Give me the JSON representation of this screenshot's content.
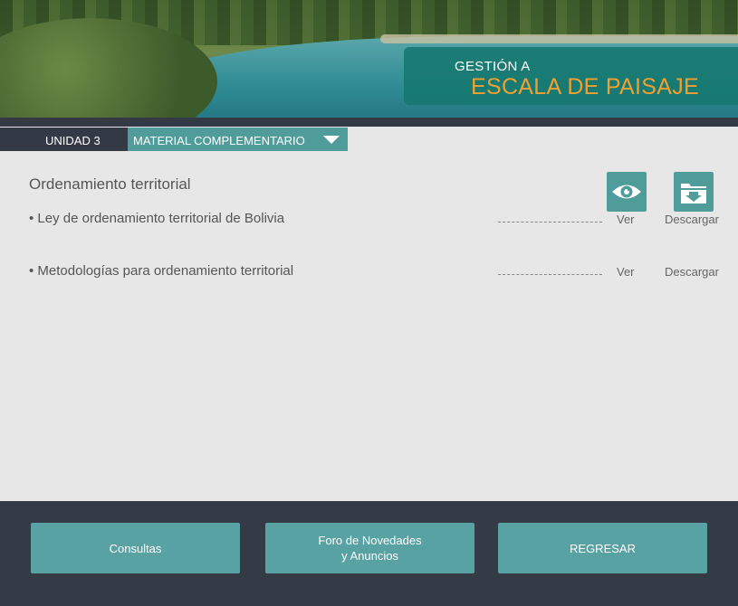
{
  "header": {
    "title_line1": "GESTIÓN A",
    "title_line2": "ESCALA DE PAISAJE",
    "accent_color": "#f0a030"
  },
  "nav": {
    "unit": "UNIDAD 3",
    "dropdown_label": "MATERIAL COMPLEMENTARIO",
    "dropdown_icon": "chevron-down-icon"
  },
  "content": {
    "section_title": "Ordenamiento territorial",
    "icons": {
      "view": "eye-icon",
      "download": "download-icon"
    },
    "items": [
      {
        "label": "• Ley de ordenamiento territorial de Bolivia",
        "view": "Ver",
        "download": "Descargar"
      },
      {
        "label": "• Metodologías para ordenamiento territorial",
        "view": "Ver",
        "download": "Descargar"
      }
    ]
  },
  "footer": {
    "consultas": "Consultas",
    "foro_line1": "Foro de Novedades",
    "foro_line2": "y Anuncios",
    "regresar": "REGRESAR"
  },
  "colors": {
    "teal": "#4f9c9a",
    "dark": "#343b47"
  }
}
